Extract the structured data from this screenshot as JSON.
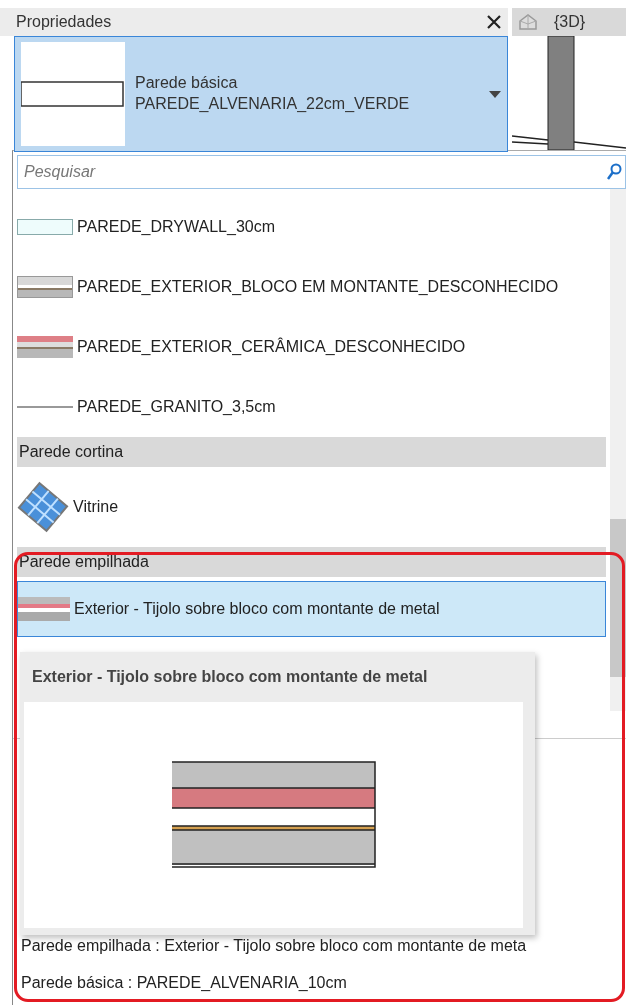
{
  "panel": {
    "title": "Propriedades"
  },
  "view_tab": {
    "title": "{3D}"
  },
  "type_selector": {
    "family": "Parede básica",
    "type": "PAREDE_ALVENARIA_22cm_VERDE"
  },
  "search": {
    "placeholder": "Pesquisar"
  },
  "list": [
    {
      "kind": "light",
      "label": "PAREDE_DRYWALL_30cm",
      "selected": false
    },
    {
      "kind": "gray",
      "label": "PAREDE_EXTERIOR_BLOCO EM MONTANTE_DESCONHECIDO",
      "selected": false
    },
    {
      "kind": "pink",
      "label": "PAREDE_EXTERIOR_CERÂMICA_DESCONHECIDO",
      "selected": false
    },
    {
      "kind": "line",
      "label": "PAREDE_GRANITO_3,5cm",
      "selected": false
    },
    {
      "kind": "header",
      "label": "Parede cortina"
    },
    {
      "kind": "curtain",
      "label": "Vitrine",
      "selected": false
    },
    {
      "kind": "header",
      "label": "Parede empilhada"
    },
    {
      "kind": "stacked",
      "label": "Exterior - Tijolo sobre bloco com montante de metal",
      "selected": true
    }
  ],
  "tooltip": {
    "title": "Exterior - Tijolo sobre bloco com montante de metal"
  },
  "recent": [
    "Parede empilhada : Exterior - Tijolo sobre bloco com montante de meta",
    "Parede básica : PAREDE_ALVENARIA_10cm"
  ]
}
